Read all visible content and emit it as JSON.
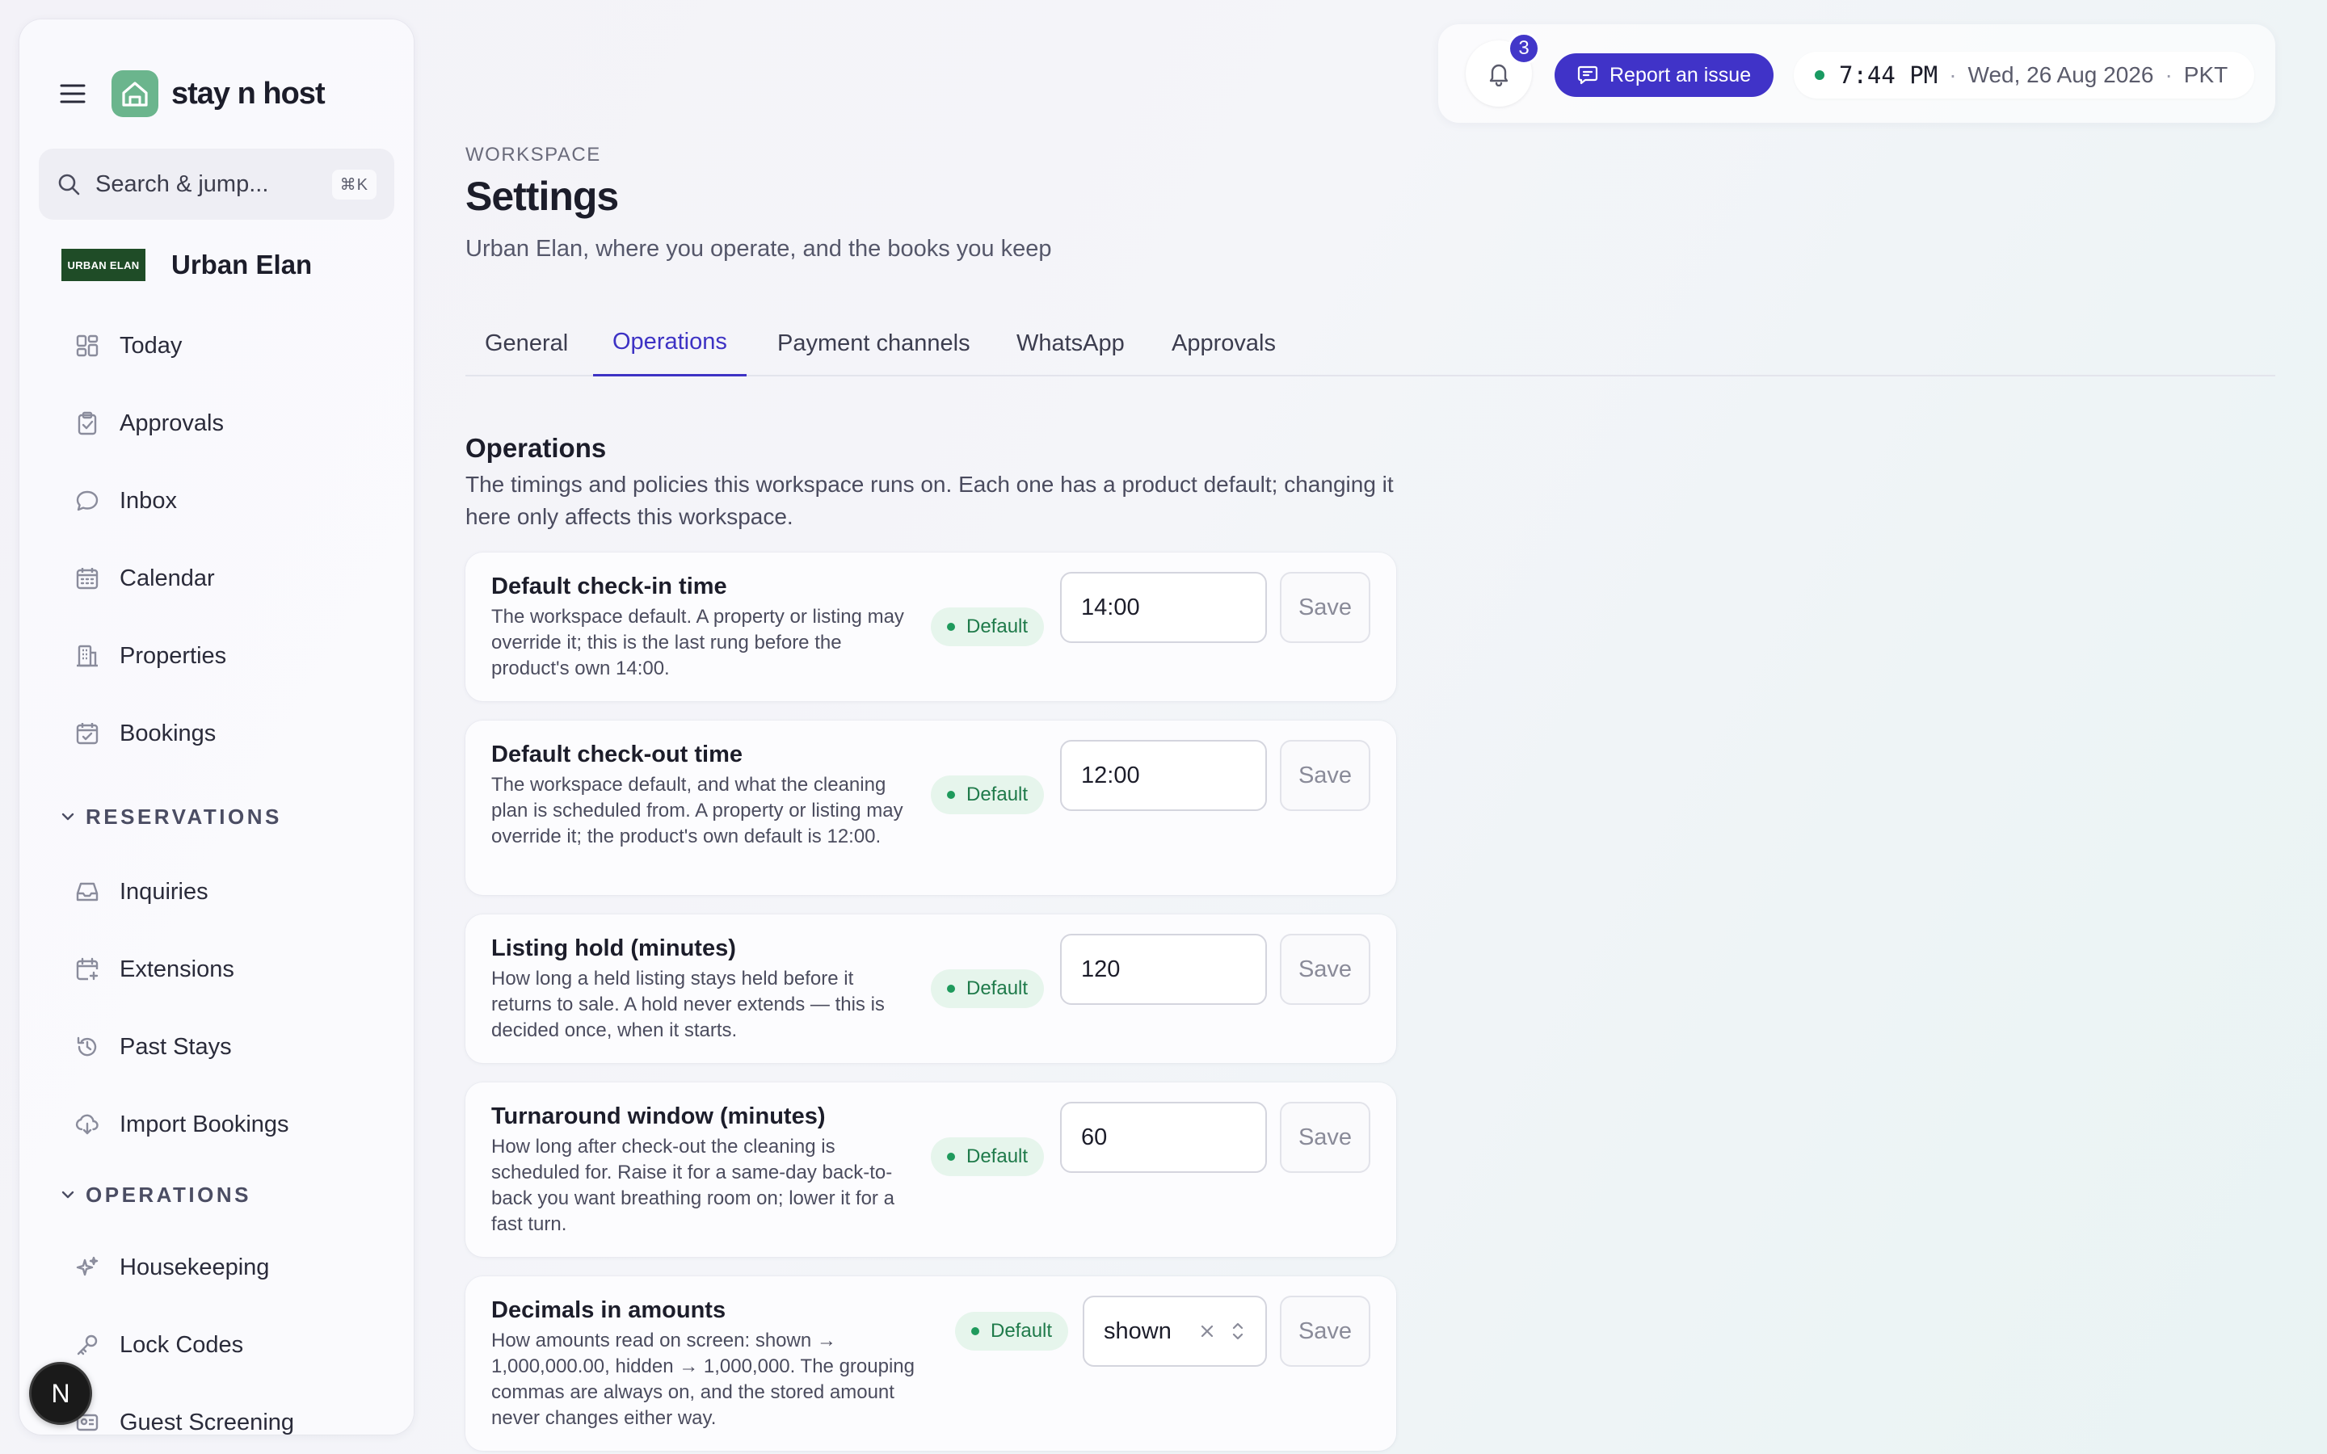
{
  "brand": {
    "name": "stay n host"
  },
  "search": {
    "placeholder": "Search & jump...",
    "shortcut": "⌘K"
  },
  "workspace": {
    "logo_text": "URBAN ELAN",
    "name": "Urban Elan"
  },
  "sidebar": {
    "top_items": [
      {
        "label": "Today",
        "icon": "dashboard-icon"
      },
      {
        "label": "Approvals",
        "icon": "clipboard-check-icon"
      },
      {
        "label": "Inbox",
        "icon": "chat-bubble-icon"
      },
      {
        "label": "Calendar",
        "icon": "calendar-icon"
      },
      {
        "label": "Properties",
        "icon": "building-icon"
      },
      {
        "label": "Bookings",
        "icon": "calendar-check-icon"
      }
    ],
    "sections": [
      {
        "label": "RESERVATIONS",
        "items": [
          {
            "label": "Inquiries",
            "icon": "inbox-tray-icon"
          },
          {
            "label": "Extensions",
            "icon": "calendar-plus-icon"
          },
          {
            "label": "Past Stays",
            "icon": "history-icon"
          },
          {
            "label": "Import Bookings",
            "icon": "cloud-download-icon"
          }
        ]
      },
      {
        "label": "OPERATIONS",
        "items": [
          {
            "label": "Housekeeping",
            "icon": "sparkles-icon"
          },
          {
            "label": "Lock Codes",
            "icon": "key-icon"
          },
          {
            "label": "Guest Screening",
            "icon": "id-card-icon"
          }
        ]
      }
    ]
  },
  "avatar": {
    "initial": "N"
  },
  "topbar": {
    "notification_count": "3",
    "report_label": "Report an issue",
    "time": "7:44 PM",
    "date": "Wed, 26 Aug 2026",
    "timezone": "PKT",
    "separator": "·"
  },
  "header": {
    "eyebrow": "WORKSPACE",
    "title": "Settings",
    "subtitle": "Urban Elan, where you operate, and the books you keep"
  },
  "tabs": [
    {
      "label": "General",
      "active": false
    },
    {
      "label": "Operations",
      "active": true
    },
    {
      "label": "Payment channels",
      "active": false
    },
    {
      "label": "WhatsApp",
      "active": false
    },
    {
      "label": "Approvals",
      "active": false
    }
  ],
  "operations": {
    "title": "Operations",
    "description": "The timings and policies this workspace runs on. Each one has a product default; changing it here only affects this workspace.",
    "settings": [
      {
        "title": "Default check-in time",
        "description": "The workspace default. A property or listing may override it; this is the last rung before the product's own 14:00.",
        "badge": "Default",
        "value": "14:00",
        "save_label": "Save"
      },
      {
        "title": "Default check-out time",
        "description": "The workspace default, and what the cleaning plan is scheduled from. A property or listing may override it; the product's own default is 12:00.",
        "badge": "Default",
        "value": "12:00",
        "save_label": "Save"
      },
      {
        "title": "Listing hold (minutes)",
        "description": "How long a held listing stays held before it returns to sale. A hold never extends — this is decided once, when it starts.",
        "badge": "Default",
        "value": "120",
        "save_label": "Save"
      },
      {
        "title": "Turnaround window (minutes)",
        "description": "How long after check-out the cleaning is scheduled for. Raise it for a same-day back-to-back you want breathing room on; lower it for a fast turn.",
        "badge": "Default",
        "value": "60",
        "save_label": "Save"
      },
      {
        "title": "Decimals in amounts",
        "description": "How amounts read on screen: shown → 1,000,000.00, hidden → 1,000,000. The grouping commas are always on, and the stored amount never changes either way.",
        "badge": "Default",
        "value": "shown",
        "save_label": "Save"
      }
    ]
  },
  "colors": {
    "accent": "#4033c8",
    "brand_green": "#6bb58d",
    "default_badge_bg": "#e6f5ec",
    "default_badge_text": "#1f7a4a",
    "workspace_logo_bg": "#1f4c27"
  }
}
